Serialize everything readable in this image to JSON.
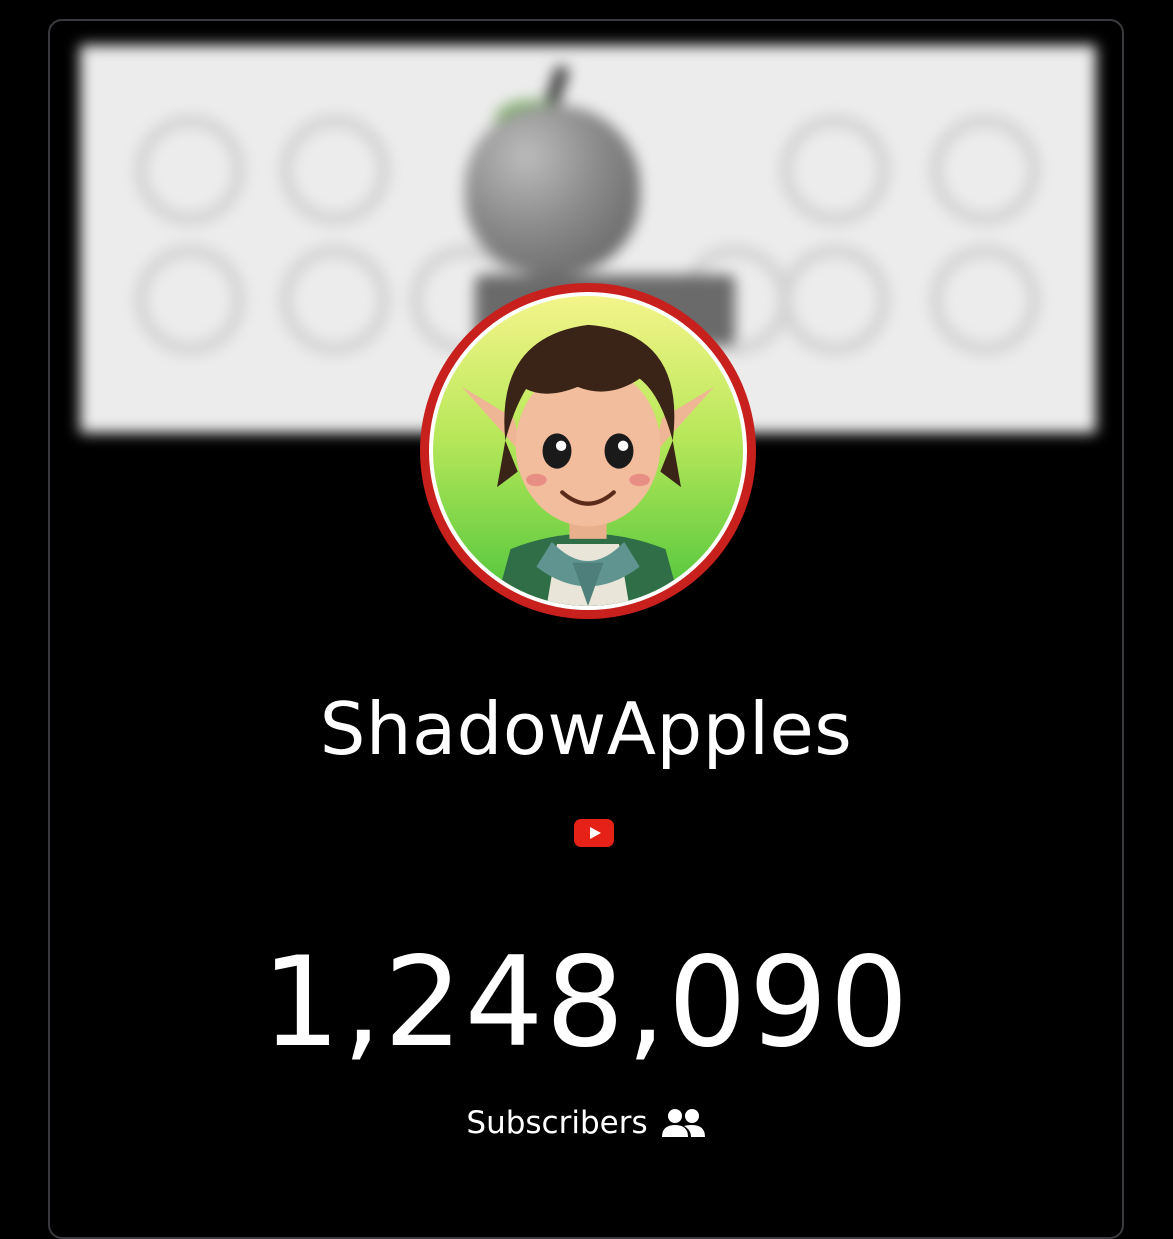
{
  "channel": {
    "name": "ShadowApples",
    "platform_icon": "youtube-play-icon",
    "subscriber_count": "1,248,090",
    "subscribers_label": "Subscribers",
    "subscribers_icon": "users-icon"
  },
  "colors": {
    "background": "#000000",
    "avatar_ring": "#c8201c",
    "youtube_red": "#e62117",
    "text": "#ffffff"
  }
}
